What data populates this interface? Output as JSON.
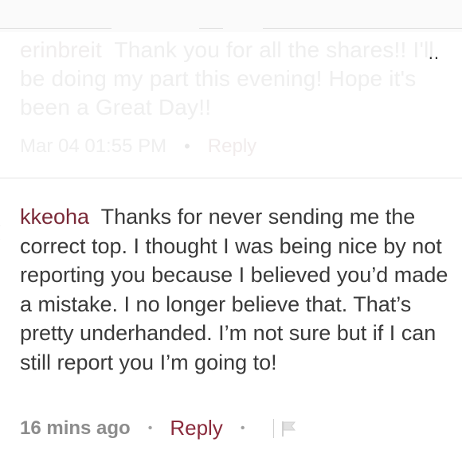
{
  "previous_comment": {
    "username": "erinbreit",
    "text": "Thank you for all the shares!! I'll be doing my part this evening! Hope it's been a Great Day!!",
    "timestamp": "Mar 04 01:55 PM",
    "reply_label": "Reply",
    "more_label": ".."
  },
  "comment": {
    "username": "kkeoha",
    "text": "Thanks for never sending me the correct top. I thought I was being nice by not reporting you because I believed you’d made a mistake. I no longer believe that. That’s pretty underhanded. I’m not sure but if I can still report you I’m going to!",
    "timestamp": "16 mins ago",
    "reply_label": "Reply",
    "separator": "•",
    "icon": "flag-icon"
  },
  "colors": {
    "username": "#7a2a38",
    "reply": "#8a2b3c",
    "text": "#3a3a3a",
    "meta": "#8c8c8c"
  }
}
